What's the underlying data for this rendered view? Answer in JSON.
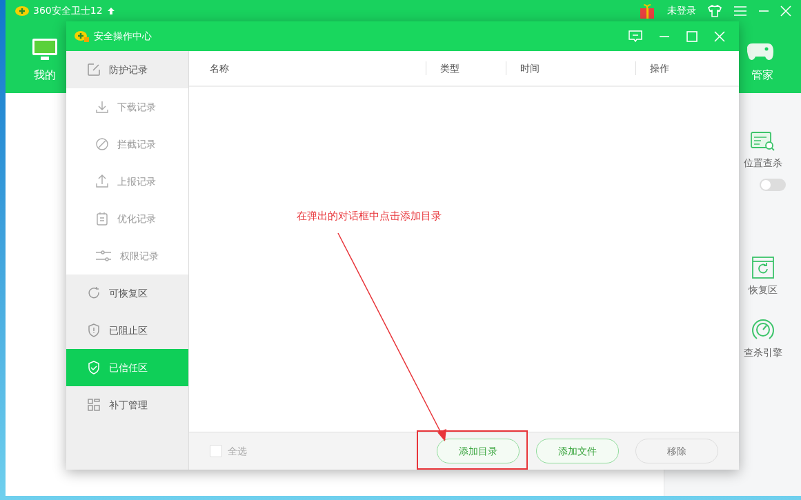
{
  "app": {
    "title": "360安全卫士12",
    "user": "未登录",
    "nav": [
      {
        "label": "我的"
      },
      {
        "label": "管家"
      }
    ],
    "right_panel": [
      {
        "label": "位置查杀",
        "kind": "scan"
      },
      {
        "label": "恢复区",
        "kind": "restore"
      },
      {
        "label": "查杀引擎",
        "kind": "engine"
      }
    ],
    "toggle": {
      "on": false
    }
  },
  "dialog": {
    "title": "安全操作中心",
    "sidebar": [
      {
        "label": "防护记录",
        "selected": false,
        "children": [
          {
            "label": "下载记录",
            "selected": false
          },
          {
            "label": "拦截记录",
            "selected": false
          },
          {
            "label": "上报记录",
            "selected": false
          },
          {
            "label": "优化记录",
            "selected": false
          },
          {
            "label": "权限记录",
            "selected": false
          }
        ]
      },
      {
        "label": "可恢复区",
        "selected": false
      },
      {
        "label": "已阻止区",
        "selected": false
      },
      {
        "label": "已信任区",
        "selected": true
      },
      {
        "label": "补丁管理",
        "selected": false
      }
    ],
    "table": {
      "columns": [
        "名称",
        "类型",
        "时间",
        "操作"
      ]
    },
    "select_all": {
      "label": "全选",
      "checked": false
    },
    "buttons": [
      {
        "label": "添加目录",
        "kind": "primary",
        "highlighted": true
      },
      {
        "label": "添加文件",
        "kind": "primary",
        "highlighted": false
      },
      {
        "label": "移除",
        "kind": "default",
        "highlighted": false
      }
    ]
  },
  "annotation": {
    "text": "在弹出的对话框中点击添加目录"
  }
}
